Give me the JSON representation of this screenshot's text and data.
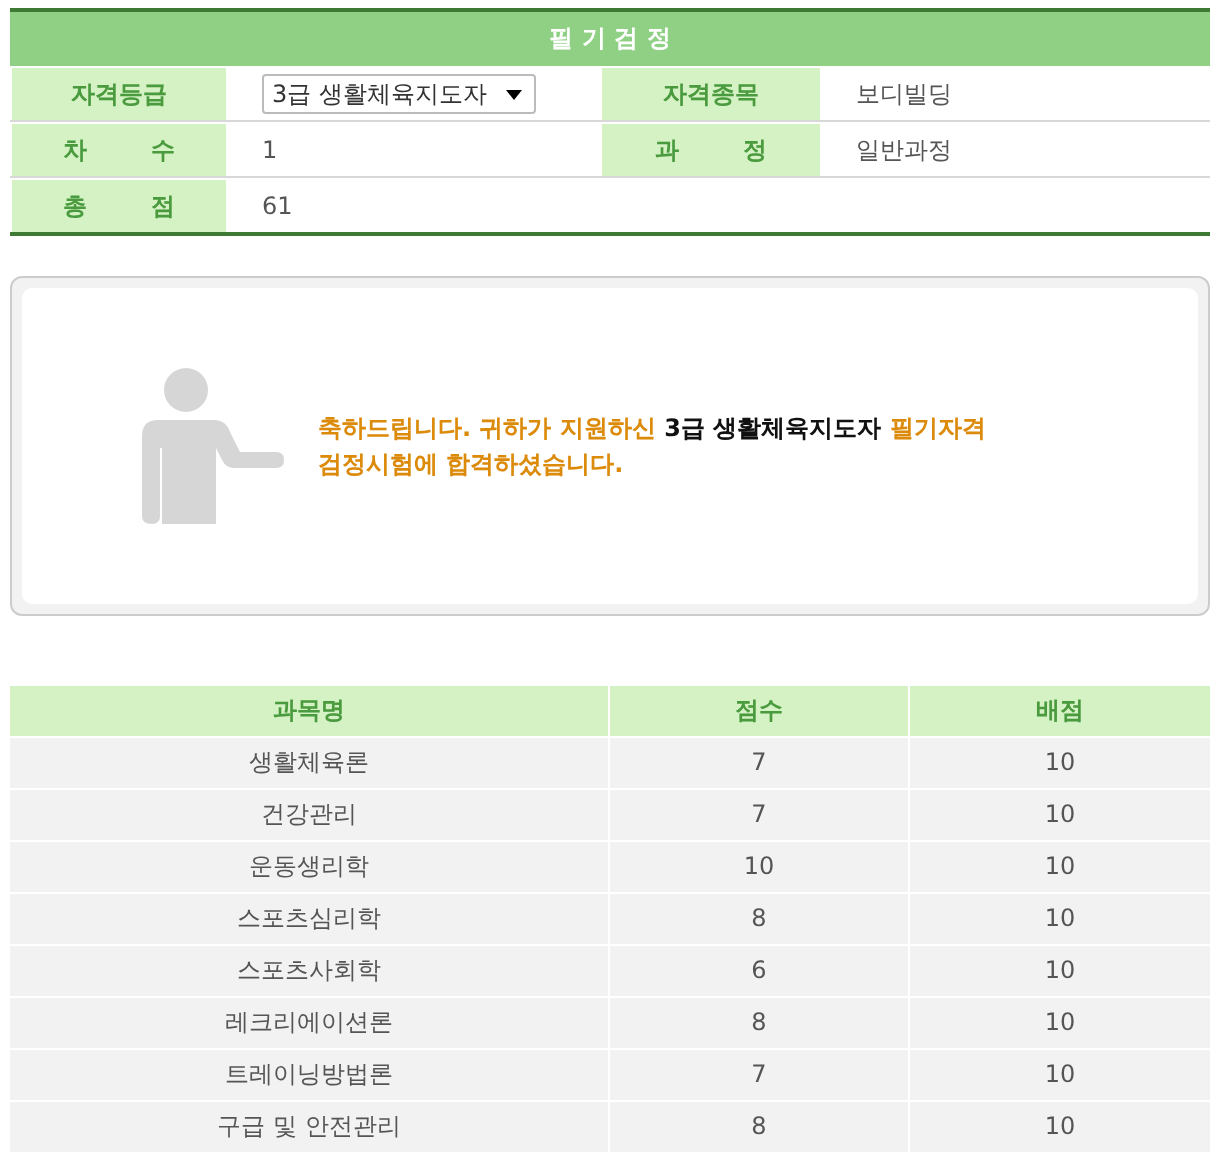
{
  "exam": {
    "title": "필 기 검 정",
    "rows": [
      [
        {
          "label": "자격등급",
          "kind": "select",
          "value": "3급 생활체육지도자"
        },
        {
          "label": "자격종목",
          "kind": "text",
          "value": "보디빌딩"
        }
      ],
      [
        {
          "label": "차 수",
          "kind": "text",
          "value": "1"
        },
        {
          "label": "과 정",
          "kind": "text",
          "value": "일반과정"
        }
      ],
      [
        {
          "label": "총 점",
          "kind": "text",
          "value": "61"
        }
      ]
    ]
  },
  "message": {
    "lines": [
      [
        {
          "text": "축하드립니다. 귀하가 지원하신 ",
          "emphasis": false
        },
        {
          "text": "3급 생활체육지도자",
          "emphasis": true
        },
        {
          "text": " 필기자격",
          "emphasis": false
        }
      ],
      [
        {
          "text": "검정시험에 합격하셨습니다.",
          "emphasis": false
        }
      ]
    ]
  },
  "scores": {
    "columns": [
      "과목명",
      "점수",
      "배점"
    ],
    "rows": [
      [
        "생활체육론",
        "7",
        "10"
      ],
      [
        "건강관리",
        "7",
        "10"
      ],
      [
        "운동생리학",
        "10",
        "10"
      ],
      [
        "스포츠심리학",
        "8",
        "10"
      ],
      [
        "스포츠사회학",
        "6",
        "10"
      ],
      [
        "레크리에이션론",
        "8",
        "10"
      ],
      [
        "트레이닝방법론",
        "7",
        "10"
      ],
      [
        "구급 및 안전관리",
        "8",
        "10"
      ]
    ]
  }
}
